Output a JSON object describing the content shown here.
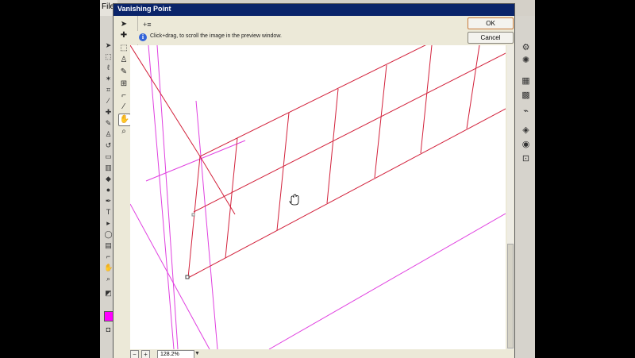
{
  "app": {
    "menu_label": "File"
  },
  "dialog": {
    "title": "Vanishing Point",
    "grid_size_label": "+≡",
    "hint": "Click+drag, to scroll the image in the preview window.",
    "ok_label": "OK",
    "cancel_label": "Cancel",
    "zoom_value": "128.2%",
    "zoom_out_label": "−",
    "zoom_in_label": "+"
  },
  "colors": {
    "plane_grid": "#d2203a",
    "guide_lines": "#e040e0",
    "foreground_swatch": "#ff00ff",
    "title_bar": "#0a246a"
  },
  "icons": {
    "dialog_tools": [
      "edit-plane-icon",
      "create-plane-icon",
      "marquee-icon",
      "stamp-icon",
      "brush-icon",
      "transform-icon",
      "eyedropper-icon",
      "measure-icon",
      "hand-icon",
      "zoom-icon"
    ],
    "left_tools": [
      "move-icon",
      "marquee-icon",
      "lasso-icon",
      "magic-wand-icon",
      "crop-icon",
      "slice-icon",
      "healing-icon",
      "brush-icon",
      "stamp-icon",
      "history-brush-icon",
      "eraser-icon",
      "gradient-icon",
      "blur-icon",
      "dodge-icon",
      "pen-icon",
      "type-icon",
      "path-select-icon",
      "shape-icon",
      "notes-icon",
      "eyedropper-icon",
      "hand-icon",
      "zoom-icon"
    ],
    "right_panel": [
      "navigator-icon",
      "info-icon",
      "swatches-icon",
      "styles-icon",
      "history-icon",
      "actions-icon",
      "layers-icon",
      "channels-icon",
      "paths-icon"
    ]
  }
}
